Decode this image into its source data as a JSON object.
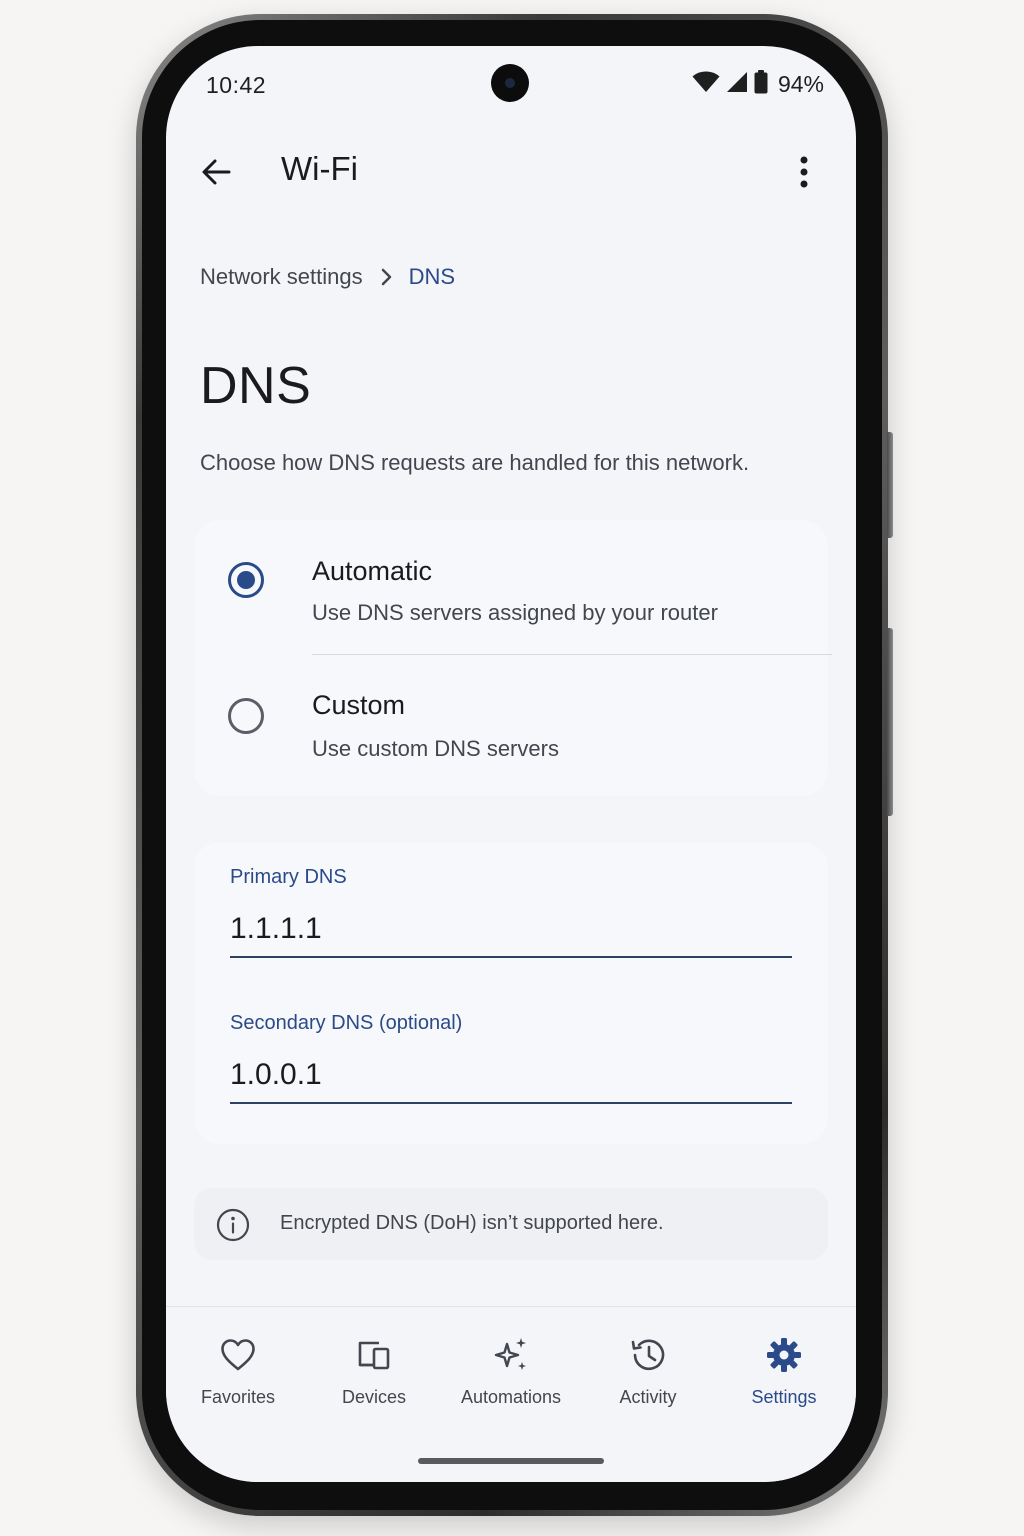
{
  "status_bar": {
    "time": "10:42",
    "battery_percent": "94%",
    "icons": [
      "wifi-icon",
      "cell-signal-icon",
      "battery-icon"
    ]
  },
  "app_bar": {
    "title": "Wi-Fi",
    "back_icon": "arrow-back-icon",
    "more_icon": "more-vert-icon"
  },
  "breadcrumb": {
    "parent": "Network settings",
    "current": "DNS"
  },
  "page": {
    "title": "DNS",
    "description": "Choose how DNS requests are handled for this network."
  },
  "dns_mode": {
    "selected": "automatic",
    "options": [
      {
        "id": "automatic",
        "title": "Automatic",
        "subtitle": "Use DNS servers assigned by your router"
      },
      {
        "id": "custom",
        "title": "Custom",
        "subtitle": "Use custom DNS servers"
      }
    ]
  },
  "fields": {
    "primary": {
      "label": "Primary DNS",
      "value": "1.1.1.1"
    },
    "secondary": {
      "label": "Secondary DNS (optional)",
      "value": "1.0.0.1"
    }
  },
  "info": {
    "icon": "info-icon",
    "text": "Encrypted DNS (DoH) isn’t supported here."
  },
  "bottom_nav": {
    "active": "settings",
    "items": [
      {
        "id": "favorites",
        "label": "Favorites",
        "icon": "heart-icon"
      },
      {
        "id": "devices",
        "label": "Devices",
        "icon": "devices-icon"
      },
      {
        "id": "automations",
        "label": "Automations",
        "icon": "sparkle-icon"
      },
      {
        "id": "activity",
        "label": "Activity",
        "icon": "history-icon"
      },
      {
        "id": "settings",
        "label": "Settings",
        "icon": "gear-icon"
      }
    ]
  },
  "colors": {
    "accent": "#2a4a8a",
    "background": "#f4f5f9",
    "text_primary": "#1b1b1f",
    "text_secondary": "#44464f"
  }
}
